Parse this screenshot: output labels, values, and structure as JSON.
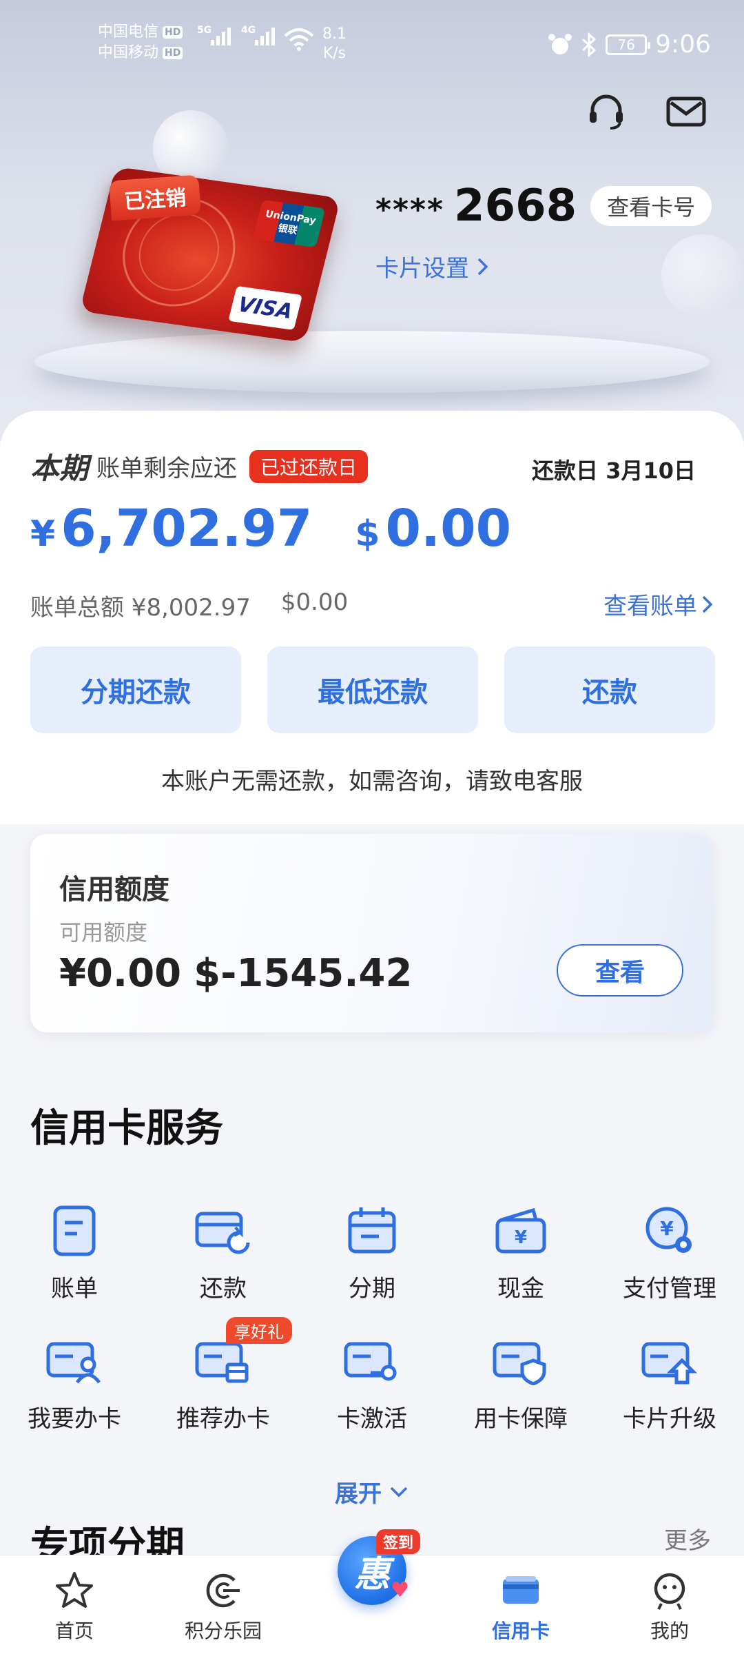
{
  "status_bar": {
    "carrier1": "中国电信",
    "carrier2": "中国移动",
    "hd": "HD",
    "net1": "5G",
    "net2": "4G",
    "speed_value": "8.1",
    "speed_unit": "K/s",
    "battery": "76",
    "time": "9:06"
  },
  "header": {
    "icons": [
      "headset-icon",
      "mail-icon"
    ]
  },
  "card": {
    "status_tag": "已注销",
    "unionpay_en": "UnionPay",
    "unionpay_cn": "银联",
    "visa": "VISA",
    "masked": "****",
    "last4": "2668",
    "view_number_label": "查看卡号",
    "settings_label": "卡片设置"
  },
  "bill": {
    "period": "本期",
    "remaining_label": "账单剩余应还",
    "overdue_tag": "已过还款日",
    "due_date": "还款日 3月10日",
    "cny_symbol": "¥",
    "cny_amount": "6,702.97",
    "usd_symbol": "$",
    "usd_amount": "0.00",
    "total_label": "账单总额 ¥8,002.97",
    "total_usd": "$0.00",
    "view_bill_label": "查看账单",
    "actions": [
      "分期还款",
      "最低还款",
      "还款"
    ],
    "notice": "本账户无需还款，如需咨询，请致电客服"
  },
  "credit": {
    "title": "信用额度",
    "subtitle": "可用额度",
    "cny": "¥0.00",
    "usd": "$-1545.42",
    "view_label": "查看"
  },
  "services": {
    "title": "信用卡服务",
    "items": [
      {
        "label": "账单",
        "icon": "bill-icon"
      },
      {
        "label": "还款",
        "icon": "repay-icon"
      },
      {
        "label": "分期",
        "icon": "calendar-icon"
      },
      {
        "label": "现金",
        "icon": "cash-wallet-icon"
      },
      {
        "label": "支付管理",
        "icon": "payment-settings-icon"
      },
      {
        "label": "我要办卡",
        "icon": "apply-card-icon"
      },
      {
        "label": "推荐办卡",
        "icon": "recommend-card-icon",
        "badge": "享好礼"
      },
      {
        "label": "卡激活",
        "icon": "card-activate-icon"
      },
      {
        "label": "用卡保障",
        "icon": "card-protection-icon"
      },
      {
        "label": "卡片升级",
        "icon": "card-upgrade-icon"
      }
    ],
    "expand_label": "展开"
  },
  "special": {
    "title": "专项分期",
    "more_label": "更多"
  },
  "nav": {
    "items": [
      {
        "label": "首页",
        "icon": "star-icon"
      },
      {
        "label": "积分乐园",
        "icon": "points-icon"
      },
      {
        "label": "",
        "icon": "checkin-icon",
        "tag": "签到"
      },
      {
        "label": "信用卡",
        "icon": "credit-card-icon"
      },
      {
        "label": "我的",
        "icon": "profile-icon"
      }
    ]
  },
  "colors": {
    "accent": "#2f6fe0",
    "danger": "#e8301f",
    "card_red": "#c9201a"
  }
}
